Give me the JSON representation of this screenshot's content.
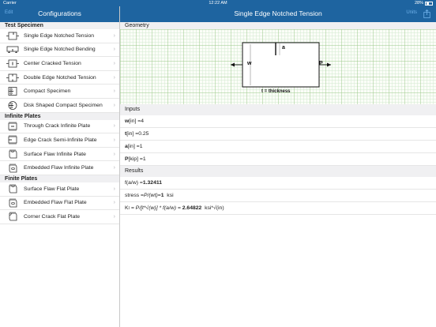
{
  "status": {
    "carrier": "Carrier",
    "time": "12:22 AM",
    "battery": "28%"
  },
  "left_nav": {
    "back": "Edit",
    "title": "Configurations"
  },
  "right_nav": {
    "title": "Single Edge Notched Tension",
    "action": "Units"
  },
  "sections": [
    {
      "title": "Test Specimen",
      "items": [
        {
          "label": "Single Edge Notched Tension",
          "icon": "sent-specimen-icon"
        },
        {
          "label": "Single Edge Notched Bending",
          "icon": "senb-specimen-icon"
        },
        {
          "label": "Center Cracked Tension",
          "icon": "cct-specimen-icon"
        },
        {
          "label": "Double Edge Notched Tension",
          "icon": "dent-specimen-icon"
        },
        {
          "label": "Compact Specimen",
          "icon": "compact-specimen-icon"
        },
        {
          "label": "Disk Shaped Compact Specimen",
          "icon": "disk-specimen-icon"
        }
      ]
    },
    {
      "title": "Infinite Plates",
      "items": [
        {
          "label": "Through Crack Infinite Plate",
          "icon": "through-crack-plate-icon"
        },
        {
          "label": "Edge Crack Semi-Infinite Plate",
          "icon": "edge-crack-plate-icon"
        },
        {
          "label": "Surface Flaw Infinite Plate",
          "icon": "surface-flaw-plate-icon"
        },
        {
          "label": "Embedded Flaw Infinite Plate",
          "icon": "embedded-flaw-plate-icon"
        }
      ]
    },
    {
      "title": "Finite Plates",
      "items": [
        {
          "label": "Surface Flaw Flat Plate",
          "icon": "surface-flaw-flat-icon"
        },
        {
          "label": "Embedded Flaw Flat Plate",
          "icon": "embedded-flaw-flat-icon"
        },
        {
          "label": "Corner Crack Flat Plate",
          "icon": "corner-crack-flat-icon"
        }
      ]
    }
  ],
  "geometry": {
    "header": "Geometry",
    "w": "w",
    "a": "a",
    "p": "P",
    "thickness": "t = thickness"
  },
  "inputs": {
    "header": "Inputs",
    "w": {
      "name": "w",
      "unit": " [in] =4"
    },
    "t": {
      "name": "t",
      "unit": " [in] =0.25"
    },
    "a": {
      "name": "a",
      "unit": " [in] =1"
    },
    "P": {
      "name": "P",
      "unit": " [kip] =1"
    }
  },
  "results": {
    "header": "Results",
    "f_label": "f(a/w) = ",
    "f_value": "1.32411",
    "stress_label": "stress = ",
    "stress_formula": "P/(wt)",
    "stress_eq": " = ",
    "stress_value": "1",
    "stress_unit": "  ksi",
    "k_label": "K",
    "k_sub": "I",
    "k_formula": " = P/[t*√(w)] * f(a/w) = ",
    "k_value": "2.64822",
    "k_unit": "  ksi*√(in)"
  },
  "colors": {
    "nav": "#1e64a0",
    "grid": "#9bc98a",
    "section_bg": "#f0f0f2"
  }
}
